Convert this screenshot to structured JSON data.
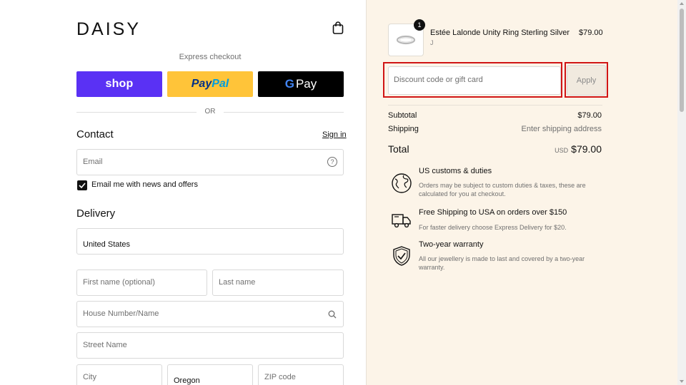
{
  "header": {
    "logo": "DAISY",
    "cart_icon": "shopping-bag-icon"
  },
  "express_checkout": {
    "label": "Express checkout",
    "shop_label": "shop",
    "paypal_label_pay": "Pay",
    "paypal_label_pal": "Pal",
    "gpay_label_g": "G",
    "gpay_label_pay": "Pay",
    "or_label": "OR"
  },
  "contact": {
    "title": "Contact",
    "signin_label": "Sign in",
    "email_placeholder": "Email",
    "newsletter_label": "Email me with news and offers",
    "newsletter_checked": true
  },
  "delivery": {
    "title": "Delivery",
    "country_value": "United States",
    "first_name_placeholder": "First name (optional)",
    "last_name_placeholder": "Last name",
    "house_placeholder": "House Number/Name",
    "street_placeholder": "Street Name",
    "city_placeholder": "City",
    "state_value": "Oregon",
    "zip_placeholder": "ZIP code"
  },
  "order": {
    "product": {
      "name": "Estée Lalonde Unity Ring Sterling Silver",
      "variant": "J",
      "price": "$79.00",
      "quantity": "1"
    },
    "discount_placeholder": "Discount code or gift card",
    "apply_label": "Apply",
    "subtotal_label": "Subtotal",
    "subtotal_value": "$79.00",
    "shipping_label": "Shipping",
    "shipping_value": "Enter shipping address",
    "total_label": "Total",
    "total_currency": "USD",
    "total_value": "$79.00"
  },
  "benefits": [
    {
      "icon": "globe-icon",
      "title": "US customs & duties",
      "desc": "Orders may be subject to custom duties & taxes, these are calculated for you at checkout."
    },
    {
      "icon": "delivery-truck-icon",
      "title": "Free Shipping to USA on orders over $150",
      "desc": "For faster delivery choose Express Delivery for $20."
    },
    {
      "icon": "shield-check-icon",
      "title": "Two-year warranty",
      "desc": "All our jewellery is made to last and covered by a two-year warranty."
    }
  ],
  "colors": {
    "shop": "#5a31f4",
    "paypal": "#ffc439",
    "gpay": "#000000",
    "summary_bg": "#fcf4e8",
    "highlight": "#d01515"
  }
}
